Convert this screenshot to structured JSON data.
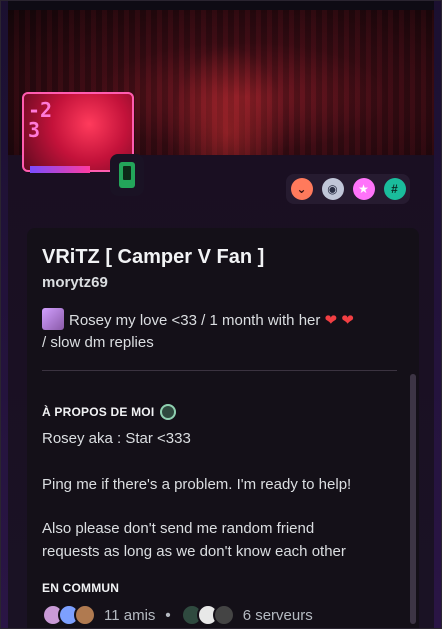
{
  "profile": {
    "display_name": "VRiTZ [ Camper V Fan ]",
    "username": "morytz69",
    "status_text": "Rosey my love <33 / 1 month with her",
    "status_text_2": "/ slow dm replies"
  },
  "avatar": {
    "text_line1": "-2",
    "text_line2": "3"
  },
  "badges": [
    "hypesquad-icon",
    "nitro-icon",
    "boost-icon",
    "hash-icon"
  ],
  "about": {
    "title": "À PROPOS DE MOI",
    "line1": "Rosey aka : Star  <333",
    "line2": "Ping me if there's a problem. I'm ready to help!",
    "line3": "Also please don't send me random friend",
    "line4": "requests as long as we don't know each other"
  },
  "common": {
    "title": "EN COMMUN",
    "friends": "11 amis",
    "servers": "6 serveurs"
  },
  "colors": {
    "online": "#23a55a",
    "heart": "#f23f43",
    "accent": "#ff5cb0"
  }
}
